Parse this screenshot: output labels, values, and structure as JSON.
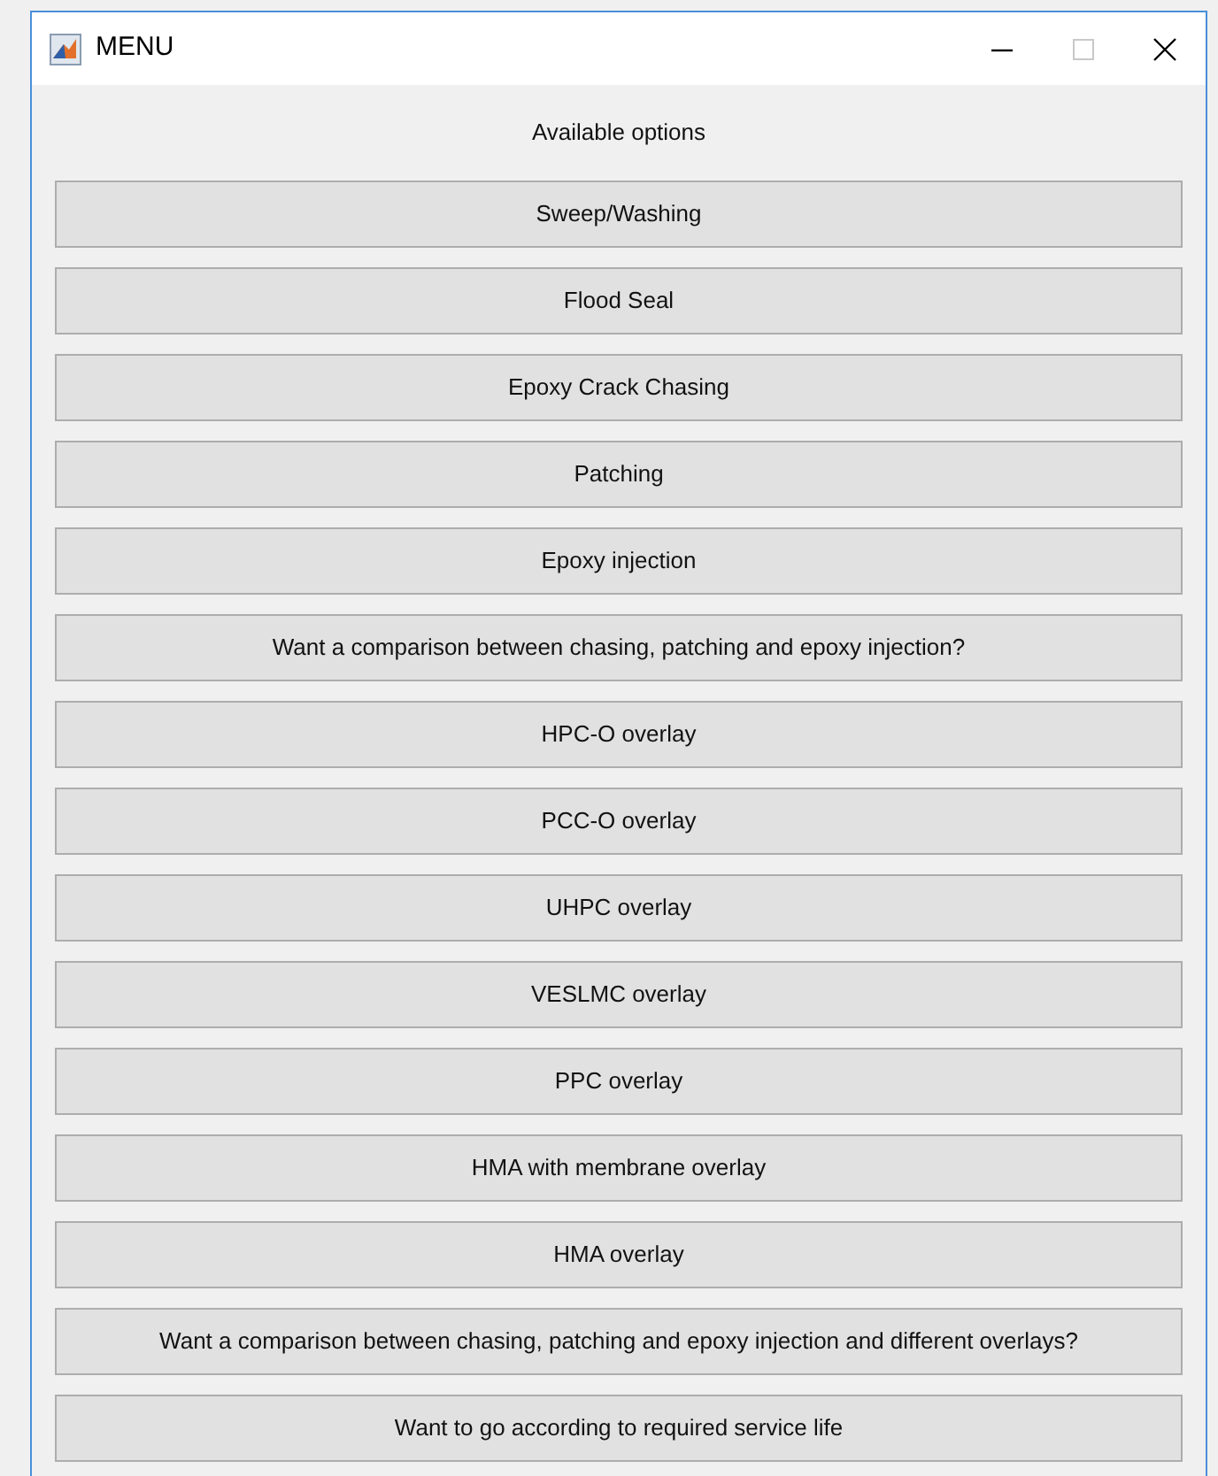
{
  "window": {
    "title": "MENU"
  },
  "heading": "Available options",
  "buttons": [
    "Sweep/Washing",
    "Flood Seal",
    "Epoxy Crack Chasing",
    "Patching",
    "Epoxy injection",
    "Want a comparison between chasing, patching and epoxy injection?",
    "HPC-O overlay",
    "PCC-O overlay",
    "UHPC overlay",
    "VESLMC overlay",
    "PPC overlay",
    "HMA with membrane overlay",
    "HMA overlay",
    "Want a comparison between chasing, patching and epoxy injection and different overlays?",
    "Want to go according to required service life"
  ]
}
